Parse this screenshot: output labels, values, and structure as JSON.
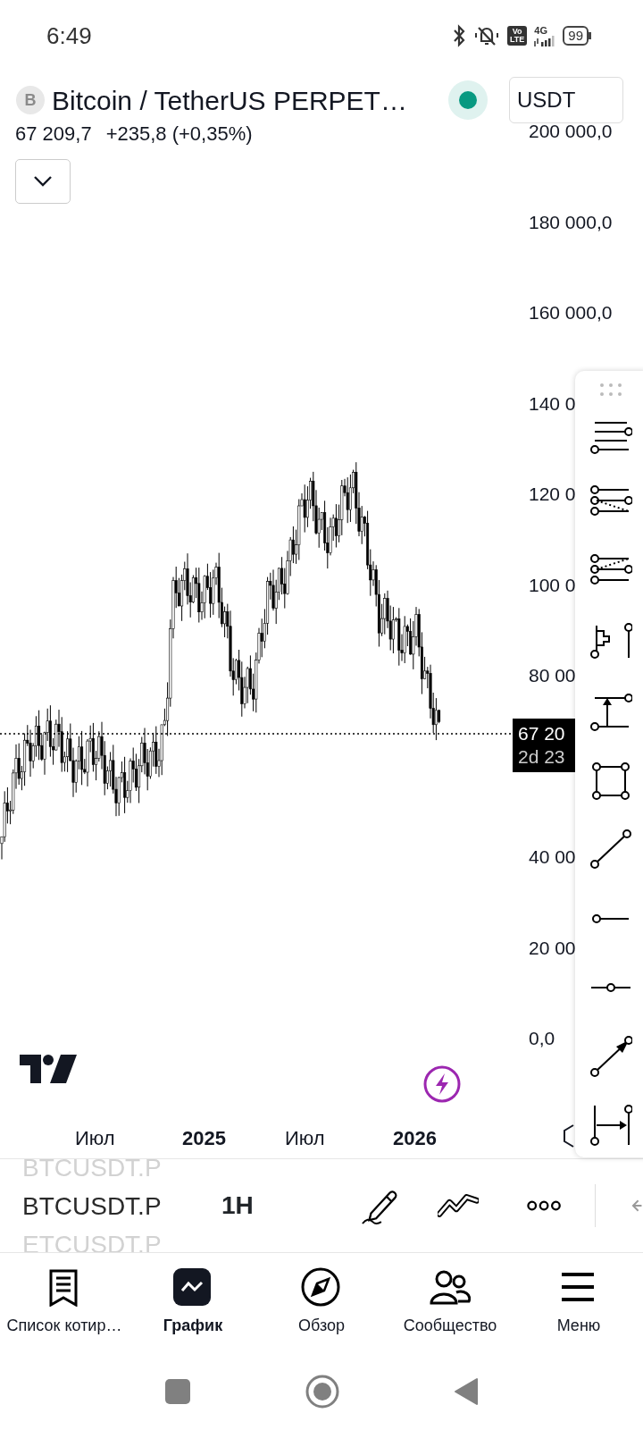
{
  "status_bar": {
    "time": "6:49",
    "volte": [
      "Vo",
      "LTE"
    ],
    "network": "4G",
    "battery": "99"
  },
  "header": {
    "symbol_logo": "B",
    "title": "Bitcoin / TetherUS PERPET…",
    "live": true,
    "currency": "USDT"
  },
  "quote": {
    "price": "67 209,7",
    "change": "+235,8 (+0,35%)"
  },
  "price_axis": [
    "200 000,0",
    "180 000,0",
    "160 000,0",
    "140 0",
    "120 0",
    "100 0",
    "80 00",
    "40 00",
    "20 00",
    "0,0"
  ],
  "price_label": {
    "price": "67 20",
    "countdown": "2d 23"
  },
  "time_axis": [
    {
      "label": "Июл",
      "bold": false
    },
    {
      "label": "2025",
      "bold": true
    },
    {
      "label": "Июл",
      "bold": false
    },
    {
      "label": "2026",
      "bold": true
    }
  ],
  "symbols": [
    {
      "label": "BTCUSDT.P",
      "selected": false
    },
    {
      "label": "BTCUSDT.P",
      "selected": true
    },
    {
      "label": "ETCUSDT.P",
      "selected": false
    }
  ],
  "interval": "1H",
  "nav": [
    {
      "label": "Список котир…",
      "selected": false
    },
    {
      "label": "График",
      "selected": true
    },
    {
      "label": "Обзор",
      "selected": false
    },
    {
      "label": "Сообщество",
      "selected": false
    },
    {
      "label": "Меню",
      "selected": false
    }
  ]
}
